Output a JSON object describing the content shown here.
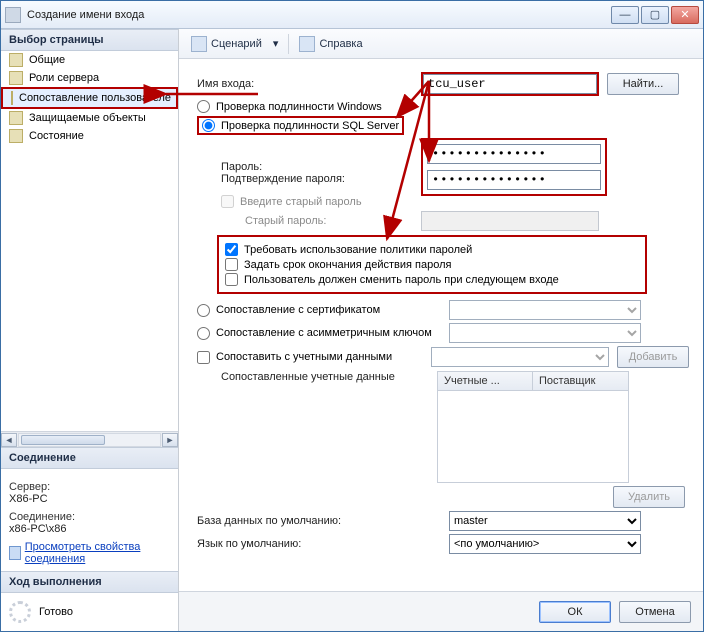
{
  "window": {
    "title": "Создание имени входа"
  },
  "winbtns": {
    "min": "—",
    "max": "▢",
    "close": "✕"
  },
  "sidebar": {
    "header": "Выбор страницы",
    "items": [
      {
        "label": "Общие"
      },
      {
        "label": "Роли сервера"
      },
      {
        "label": "Сопоставление пользователе"
      },
      {
        "label": "Защищаемые объекты"
      },
      {
        "label": "Состояние"
      }
    ],
    "conn_header": "Соединение",
    "server_lbl": "Сервер:",
    "server_val": "X86-PC",
    "conn_lbl": "Соединение:",
    "conn_val": "x86-PC\\x86",
    "view_link": "Просмотреть свойства соединения",
    "prog_header": "Ход выполнения",
    "ready": "Готово"
  },
  "toolbar": {
    "script": "Сценарий",
    "help": "Справка",
    "dropdown": "▾"
  },
  "form": {
    "login_lbl": "Имя входа:",
    "login_val": "tcu_user",
    "find": "Найти...",
    "auth_win": "Проверка подлинности Windows",
    "auth_sql": "Проверка подлинности SQL Server",
    "pwd_lbl": "Пароль:",
    "pwd_val": "••••••••••••••",
    "pwd2_lbl": "Подтверждение пароля:",
    "pwd2_val": "••••••••••••••",
    "oldpwd_chk": "Введите старый пароль",
    "oldpwd_lbl": "Старый пароль:",
    "policy": "Требовать использование политики паролей",
    "expire": "Задать срок окончания действия пароля",
    "mustchange": "Пользователь должен сменить пароль при следующем входе",
    "cert": "Сопоставление с сертификатом",
    "akey": "Сопоставление с асимметричным ключом",
    "cred_chk": "Сопоставить с учетными данными",
    "cred_add": "Добавить",
    "cred_lbl": "Сопоставленные учетные данные",
    "th1": "Учетные ...",
    "th2": "Поставщик",
    "cred_remove": "Удалить",
    "defdb_lbl": "База данных по умолчанию:",
    "defdb_val": "master",
    "deflang_lbl": "Язык по умолчанию:",
    "deflang_val": "<по умолчанию>"
  },
  "footer": {
    "ok": "ОК",
    "cancel": "Отмена"
  },
  "colors": {
    "highlight": "#b30000"
  }
}
